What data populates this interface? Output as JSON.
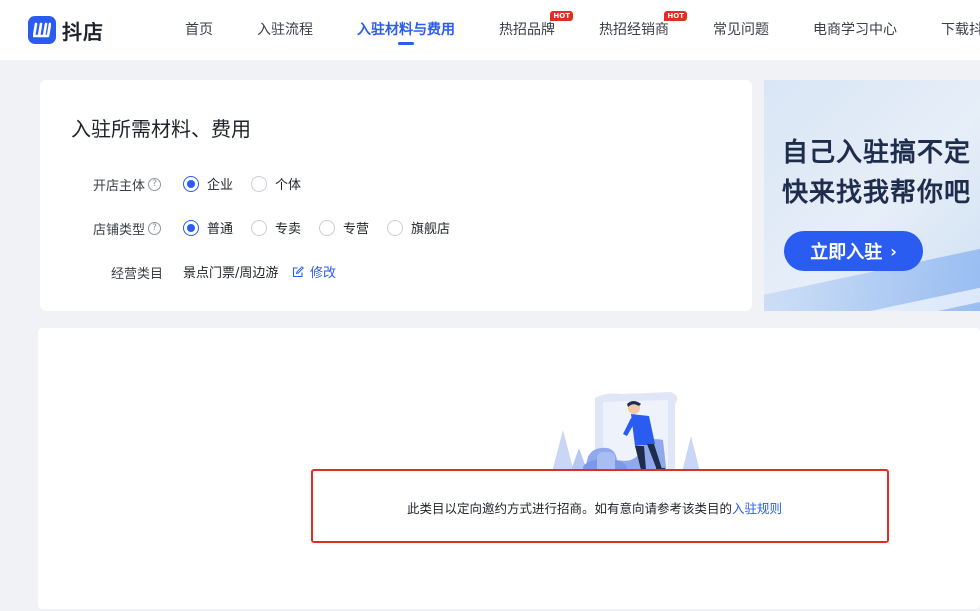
{
  "header": {
    "logo_text": "抖店",
    "nav": [
      {
        "label": "首页"
      },
      {
        "label": "入驻流程"
      },
      {
        "label": "入驻材料与费用",
        "active": true
      },
      {
        "label": "热招品牌",
        "badge": "HOT"
      },
      {
        "label": "热招经销商",
        "badge": "HOT"
      },
      {
        "label": "常见问题"
      },
      {
        "label": "电商学习中心"
      },
      {
        "label": "下载抖"
      }
    ]
  },
  "info": {
    "title": "入驻所需材料、费用",
    "entity": {
      "label": "开店主体",
      "help_icon": "?",
      "options": [
        "企业",
        "个体"
      ],
      "selected": "企业"
    },
    "store_type": {
      "label": "店铺类型",
      "help_icon": "?",
      "options": [
        "普通",
        "专卖",
        "专营",
        "旗舰店"
      ],
      "selected": "普通"
    },
    "category": {
      "label": "经营类目",
      "value": "景点门票/周边游",
      "modify_label": "修改"
    }
  },
  "banner": {
    "line1": "自己入驻搞不定",
    "line2": "快来找我帮你吧",
    "button_label": "立即入驻",
    "button_icon": "chevron-right"
  },
  "notice": {
    "text": "此类目以定向邀约方式进行招商。如有意向请参考该类目的",
    "link_label": "入驻规则"
  },
  "colors": {
    "accent": "#2b5cf2",
    "highlight_border": "#e02e24",
    "hot_badge": "#e02e24",
    "page_bg": "#f0f2f5"
  }
}
